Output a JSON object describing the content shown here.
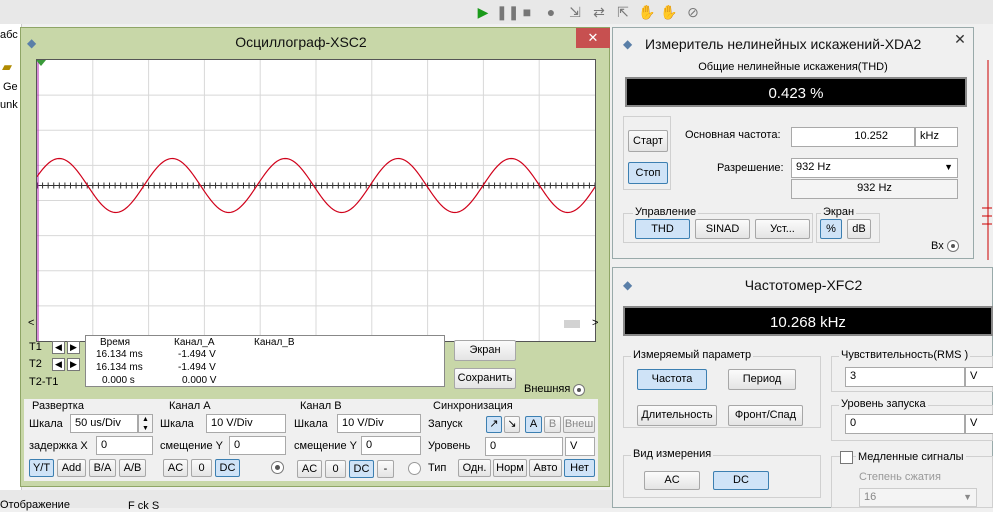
{
  "background": {
    "toolbar_icons": [
      "play-icon",
      "pause-icon",
      "stop-icon",
      "probe-icon",
      "step-in-icon",
      "step-over-icon",
      "step-out-icon",
      "hand-icon",
      "pause-circle-icon"
    ],
    "left_texts": [
      "абс",
      "Ge",
      "unk"
    ],
    "bottom_left": "Отображение",
    "bottom_mid": "F  ck  S"
  },
  "oscilloscope": {
    "title": "Осциллограф-XSC2",
    "cursor_rows": [
      "T1",
      "T2",
      "T2-T1"
    ],
    "readout": {
      "headers": [
        "Время",
        "Канал_A",
        "Канал_B"
      ],
      "rows": [
        {
          "time": "16.134 ms",
          "a": "-1.494 V",
          "b": ""
        },
        {
          "time": "16.134 ms",
          "a": "-1.494 V",
          "b": ""
        },
        {
          "time": "0.000 s",
          "a": "0.000 V",
          "b": ""
        }
      ]
    },
    "buttons": {
      "screen": "Экран",
      "save": "Сохранить"
    },
    "external_label": "Внешняя",
    "timebase": {
      "group": "Развертка",
      "scale_label": "Шкала",
      "scale_value": "50 us/Div",
      "delay_label": "задержка X",
      "delay_value": "0",
      "modes": [
        "Y/T",
        "Add",
        "B/A",
        "A/B"
      ]
    },
    "channel_a": {
      "group": "Канал A",
      "scale_label": "Шкала",
      "scale_value": "10  V/Div",
      "offset_label": "смещение Y",
      "offset_value": "0",
      "coupling": [
        "AC",
        "0",
        "DC"
      ]
    },
    "channel_b": {
      "group": "Канал B",
      "scale_label": "Шкала",
      "scale_value": "10  V/Div",
      "offset_label": "смещение Y",
      "offset_value": "0",
      "coupling": [
        "AC",
        "0",
        "DC",
        "-"
      ]
    },
    "trigger": {
      "group": "Синхронизация",
      "edge_label": "Запуск",
      "sources": [
        "A",
        "B",
        "Внеш"
      ],
      "level_label": "Уровень",
      "level_value": "0",
      "level_unit": "V",
      "type_label": "Тип",
      "types": [
        "Одн.",
        "Норм",
        "Авто",
        "Нет"
      ]
    }
  },
  "distortion_analyzer": {
    "title": "Измеритель нелинейных искажений-XDA2",
    "thd_caption": "Общие нелинейные искажения(THD)",
    "thd_value": "0.423 %",
    "start": "Старт",
    "stop": "Стоп",
    "fundamental_label": "Основная частота:",
    "fundamental_value": "10.252",
    "fundamental_unit": "kHz",
    "resolution_label": "Разрешение:",
    "resolution_select": "932 Hz",
    "resolution_value": "932 Hz",
    "control_group": "Управление",
    "control_buttons": [
      "THD",
      "SINAD",
      "Уст..."
    ],
    "display_group": "Экран",
    "display_buttons": [
      "%",
      "dB"
    ],
    "input_label": "Вх"
  },
  "frequency_counter": {
    "title": "Частотомер-XFC2",
    "display_value": "10.268 kHz",
    "measure_group": "Измеряемый параметр",
    "measure_buttons": [
      "Частота",
      "Период",
      "Длительность",
      "Фронт/Спад"
    ],
    "sensitivity_label": "Чувствительность(RMS )",
    "sensitivity_value": "3",
    "sensitivity_unit": "V",
    "trigger_level_label": "Уровень запуска",
    "trigger_level_value": "0",
    "trigger_level_unit": "V",
    "mode_group": "Вид измерения",
    "mode_buttons": [
      "AC",
      "DC"
    ],
    "slow_signals_label": "Медленные сигналы",
    "compression_label": "Степень сжатия",
    "compression_value": "16"
  },
  "colors": {
    "trace": "#d0021b",
    "osc_frame": "#c8d7a8",
    "active_button": "#cfe3f7"
  }
}
